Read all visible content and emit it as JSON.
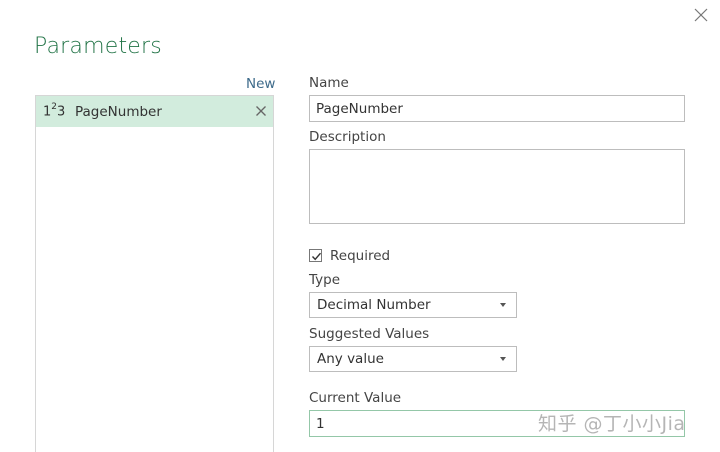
{
  "dialog": {
    "title": "Parameters",
    "new_label": "New"
  },
  "parameters": [
    {
      "type_icon": "number-type-icon",
      "type_icon_text": "123",
      "name": "PageNumber",
      "selected": true
    }
  ],
  "form": {
    "name_label": "Name",
    "name_value": "PageNumber",
    "description_label": "Description",
    "description_value": "",
    "required_label": "Required",
    "required_checked": true,
    "type_label": "Type",
    "type_value": "Decimal Number",
    "suggested_label": "Suggested Values",
    "suggested_value": "Any value",
    "current_label": "Current Value",
    "current_value": "1"
  },
  "watermark": "知乎 @丁小小Jia",
  "colors": {
    "title_green": "#217346",
    "selected_row": "#d2ecdd",
    "link_blue": "#3d6a8a"
  }
}
